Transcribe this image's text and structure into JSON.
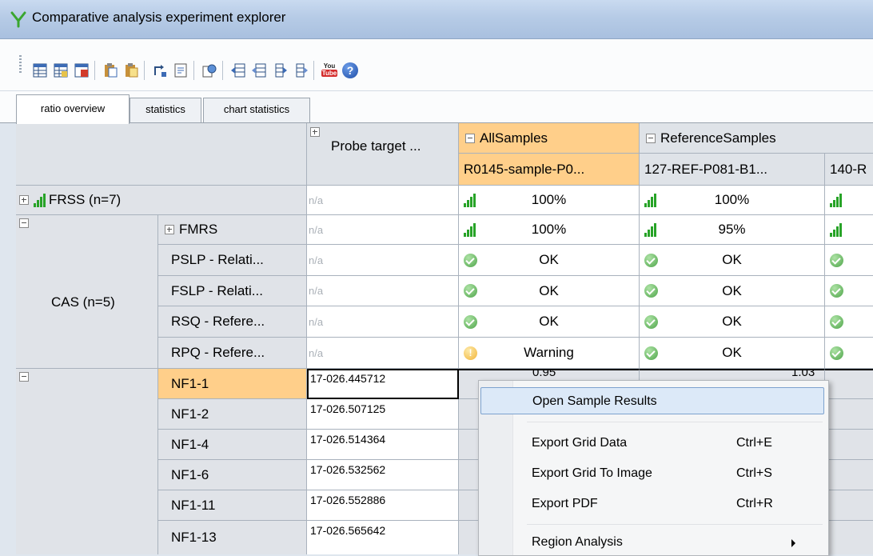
{
  "window": {
    "title": "Comparative analysis experiment explorer"
  },
  "toolbar": {
    "icons": [
      "grid-icon",
      "grid-icon",
      "grid-pdf-icon",
      "paste-icon",
      "paste-icon",
      "swap-icon",
      "document-icon",
      "copy-icon",
      "column-left-icon",
      "column-left-icon",
      "column-right-icon",
      "column-right-icon",
      "youtube-icon",
      "help-icon"
    ],
    "youtube_top": "You",
    "youtube_bottom": "Tube",
    "help_label": "?"
  },
  "tabs": [
    {
      "label": "ratio overview",
      "active": true
    },
    {
      "label": "statistics"
    },
    {
      "label": "chart statistics"
    }
  ],
  "grid": {
    "probe_header": "Probe target ...",
    "groups": {
      "all": "AllSamples",
      "reference": "ReferenceSamples"
    },
    "samples": [
      "R0145-sample-P0...",
      "127-REF-P081-B1...",
      "140-R"
    ],
    "na": "n/a",
    "frss": {
      "label": "FRSS (n=7)",
      "values": [
        "100%",
        "100%"
      ]
    },
    "cas": {
      "label": "CAS (n=5)",
      "fmrs": {
        "label": "FMRS",
        "values": [
          "100%",
          "95%"
        ]
      },
      "checks": [
        {
          "label": "PSLP - Relati...",
          "values": [
            "OK",
            "OK"
          ],
          "status": [
            "ok",
            "ok",
            "ok"
          ]
        },
        {
          "label": "FSLP - Relati...",
          "values": [
            "OK",
            "OK"
          ],
          "status": [
            "ok",
            "ok",
            "ok"
          ]
        },
        {
          "label": "RSQ - Refere...",
          "values": [
            "OK",
            "OK"
          ],
          "status": [
            "ok",
            "ok",
            "ok"
          ]
        },
        {
          "label": "RPQ - Refere...",
          "values": [
            "Warning",
            "OK"
          ],
          "status": [
            "warn",
            "ok",
            "ok"
          ]
        }
      ]
    },
    "probes": [
      {
        "label": "NF1-1",
        "target": "17-026.445712"
      },
      {
        "label": "NF1-2",
        "target": "17-026.507125"
      },
      {
        "label": "NF1-4",
        "target": "17-026.514364"
      },
      {
        "label": "NF1-6",
        "target": "17-026.532562"
      },
      {
        "label": "NF1-11",
        "target": "17-026.552886"
      },
      {
        "label": "NF1-13",
        "target": "17-026.565642"
      }
    ],
    "partial_values": [
      "0.95",
      "1.03"
    ]
  },
  "context_menu": {
    "items": [
      {
        "label": "Open Sample Results",
        "shortcut": ""
      },
      {
        "label": "Export Grid Data",
        "shortcut": "Ctrl+E"
      },
      {
        "label": "Export Grid To Image",
        "shortcut": "Ctrl+S"
      },
      {
        "label": "Export PDF",
        "shortcut": "Ctrl+R"
      },
      {
        "label": "Region Analysis",
        "shortcut": ""
      }
    ]
  },
  "colors": {
    "accent_orange": "#ffcf8a",
    "signal_green": "#27a327",
    "ok_green": "#4fa54a",
    "warning_amber": "#f2b53a"
  }
}
